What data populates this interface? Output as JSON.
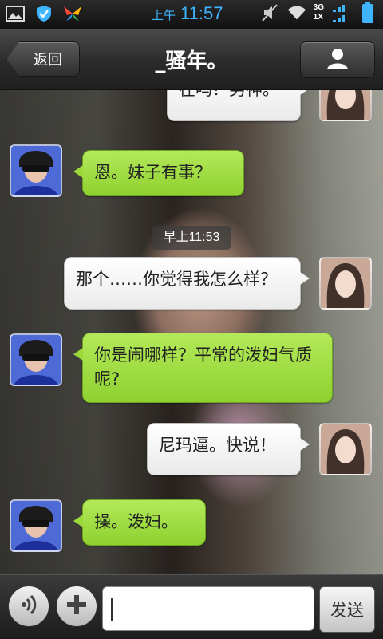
{
  "status_bar": {
    "ampm": "上午",
    "time": "11:57",
    "network_type": "3G",
    "sim_label": "1X",
    "icons": [
      "image-icon",
      "shield-icon",
      "butterfly-icon",
      "mute-icon",
      "wifi-icon",
      "signal-icon",
      "battery-icon"
    ]
  },
  "header": {
    "back_label": "返回",
    "title": "_骚年。",
    "profile_icon": "person-icon"
  },
  "chat": {
    "timestamp": "早上11:53",
    "messages": [
      {
        "sender": "me",
        "text": "在吗？男神。"
      },
      {
        "sender": "friend",
        "text": "恩。妹子有事？"
      },
      {
        "sender": "me",
        "text": "那个……你觉得我怎么样？"
      },
      {
        "sender": "friend",
        "text": "你是闹哪样？平常的泼妇气质呢?"
      },
      {
        "sender": "me",
        "text": "尼玛逼。快说！"
      },
      {
        "sender": "friend",
        "text": "操。泼妇。"
      }
    ]
  },
  "input_bar": {
    "voice_icon": "voice-icon",
    "plus_icon": "plus-icon",
    "input_value": "",
    "send_label": "发送"
  },
  "colors": {
    "accent_blue": "#3fb5ff",
    "bubble_green": "#9cd93b",
    "bubble_white": "#f4f4f4"
  }
}
